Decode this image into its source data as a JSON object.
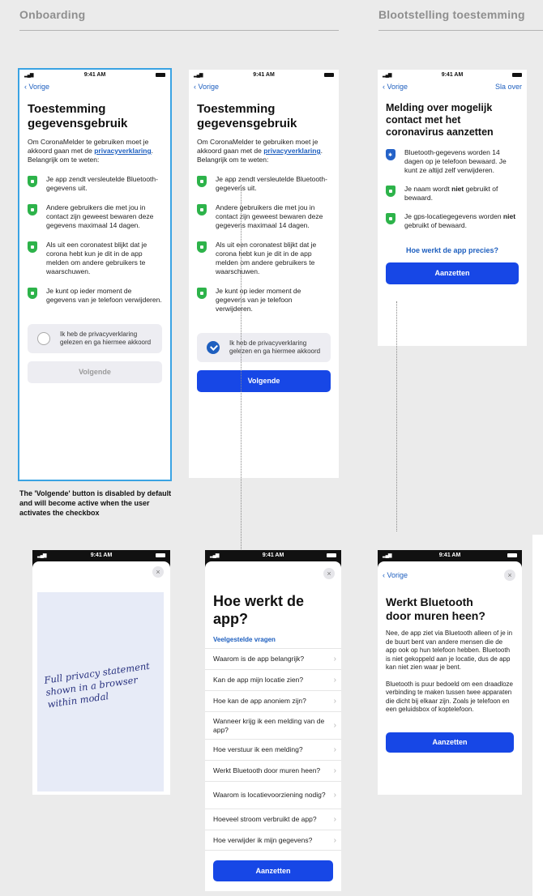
{
  "sections": {
    "onboarding": "Onboarding",
    "consent": "Blootstelling toestemming"
  },
  "status": {
    "time": "9:41 AM",
    "signal": "all"
  },
  "nav": {
    "back": "Vorige",
    "skip": "Sla over"
  },
  "consent_screen": {
    "title_line1": "Toestemming",
    "title_line2": "gegevensgebruik",
    "intro_before": "Om CoronaMelder te gebruiken moet je akkoord gaan met de ",
    "intro_link": "privacyverklaring",
    "intro_after": ". Belangrijk om te weten:",
    "bullets": [
      "Je app zendt versleutelde Bluetooth-gegevens uit.",
      "Andere gebruikers die met jou in contact zijn geweest bewaren deze gegevens maximaal 14 dagen.",
      "Als uit een coronatest blijkt dat je corona hebt kun je dit in de app melden om andere gebruikers te waarschuwen.",
      "Je kunt op ieder moment de gegevens van je telefoon verwijderen."
    ],
    "checkbox_label": "Ik heb de privacyverklaring gelezen en ga hiermee akkoord",
    "next_button": "Volgende"
  },
  "caption": "The 'Volgende' button is disabled by default and will become active when the user activates the checkbox",
  "notification_screen": {
    "title": "Melding over mogelijk contact met het coronavirus aanzetten",
    "bullet1": "Bluetooth-gegevens worden 14 dagen op je telefoon bewaard. Je kunt ze altijd zelf verwijderen.",
    "bullet2_a": "Je naam wordt ",
    "bullet2_b": "niet",
    "bullet2_c": " gebruikt of bewaard.",
    "bullet3_a": "Je gps-locatiegegevens worden ",
    "bullet3_b": "niet",
    "bullet3_c": " gebruikt of bewaard.",
    "how_link": "Hoe werkt de app precies?",
    "enable_button": "Aanzetten"
  },
  "modal": {
    "close": "×",
    "note": "Full privacy statement shown in a browser within modal"
  },
  "faq": {
    "title": "Hoe werkt de app?",
    "heading": "Veelgestelde vragen",
    "items": [
      "Waarom is de app belangrijk?",
      "Kan de app mijn locatie zien?",
      "Hoe kan de app anoniem zijn?",
      "Wanneer krijg ik een melding van de app?",
      "Hoe verstuur ik een melding?",
      "Werkt Bluetooth door muren heen?",
      "Waarom is locatievoorziening nodig?",
      "Hoeveel stroom verbruikt de app?",
      "Hoe verwijder ik mijn gegevens?"
    ],
    "button": "Aanzetten"
  },
  "bluetooth": {
    "title_line1": "Werkt Bluetooth",
    "title_line2": "door muren heen?",
    "para1": "Nee, de app ziet via Bluetooth alleen of je in de buurt bent van andere mensen die de app ook op hun telefoon hebben. Bluetooth is niet gekoppeld aan je locatie, dus de app kan niet zien waar je bent.",
    "para2": "Bluetooth is puur bedoeld om een draadloze verbinding te maken tussen twee apparaten die dicht bij elkaar zijn. Zoals je telefoon en een geluidsbox of koptelefoon.",
    "button": "Aanzetten"
  },
  "colors": {
    "accent": "#1747e6",
    "link": "#1e5fbf",
    "shield": "#2db34a",
    "highlight": "#3aa3e3"
  }
}
